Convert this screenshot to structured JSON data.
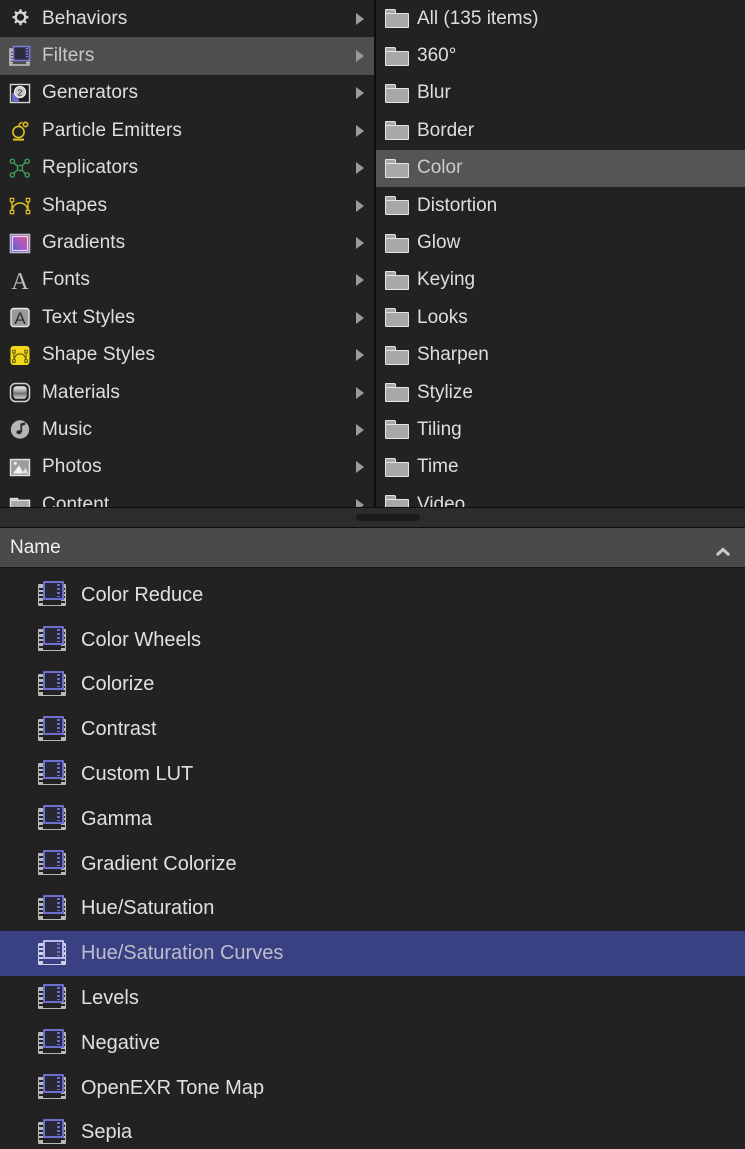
{
  "library": {
    "categories": [
      {
        "label": "Behaviors",
        "icon": "gear-icon",
        "selected": false,
        "has_submenu": true
      },
      {
        "label": "Filters",
        "icon": "film-strip-icon",
        "selected": true,
        "has_submenu": true
      },
      {
        "label": "Generators",
        "icon": "generator-icon",
        "selected": false,
        "has_submenu": true
      },
      {
        "label": "Particle Emitters",
        "icon": "particle-emitter-icon",
        "selected": false,
        "has_submenu": true
      },
      {
        "label": "Replicators",
        "icon": "replicator-icon",
        "selected": false,
        "has_submenu": true
      },
      {
        "label": "Shapes",
        "icon": "shape-curve-icon",
        "selected": false,
        "has_submenu": true
      },
      {
        "label": "Gradients",
        "icon": "gradient-swatch-icon",
        "selected": false,
        "has_submenu": true
      },
      {
        "label": "Fonts",
        "icon": "font-a-icon",
        "selected": false,
        "has_submenu": true
      },
      {
        "label": "Text Styles",
        "icon": "text-style-icon",
        "selected": false,
        "has_submenu": true
      },
      {
        "label": "Shape Styles",
        "icon": "shape-style-icon",
        "selected": false,
        "has_submenu": true
      },
      {
        "label": "Materials",
        "icon": "material-sphere-icon",
        "selected": false,
        "has_submenu": true
      },
      {
        "label": "Music",
        "icon": "music-note-icon",
        "selected": false,
        "has_submenu": true
      },
      {
        "label": "Photos",
        "icon": "photo-icon",
        "selected": false,
        "has_submenu": true
      },
      {
        "label": "Content",
        "icon": "folder-icon",
        "selected": false,
        "has_submenu": true
      }
    ],
    "subcategories": [
      {
        "label": "All (135 items)",
        "icon": "folder-icon",
        "selected": false
      },
      {
        "label": "360°",
        "icon": "folder-icon",
        "selected": false
      },
      {
        "label": "Blur",
        "icon": "folder-icon",
        "selected": false
      },
      {
        "label": "Border",
        "icon": "folder-icon",
        "selected": false
      },
      {
        "label": "Color",
        "icon": "folder-icon",
        "selected": true
      },
      {
        "label": "Distortion",
        "icon": "folder-icon",
        "selected": false
      },
      {
        "label": "Glow",
        "icon": "folder-icon",
        "selected": false
      },
      {
        "label": "Keying",
        "icon": "folder-icon",
        "selected": false
      },
      {
        "label": "Looks",
        "icon": "folder-icon",
        "selected": false
      },
      {
        "label": "Sharpen",
        "icon": "folder-icon",
        "selected": false
      },
      {
        "label": "Stylize",
        "icon": "folder-icon",
        "selected": false
      },
      {
        "label": "Tiling",
        "icon": "folder-icon",
        "selected": false
      },
      {
        "label": "Time",
        "icon": "folder-icon",
        "selected": false
      },
      {
        "label": "Video",
        "icon": "folder-icon",
        "selected": false
      }
    ]
  },
  "splitter": {
    "handle_name": "horizontal-splitter-handle"
  },
  "list_header": {
    "column_name": "Name",
    "sort_direction_icon": "chevron-up-icon"
  },
  "filter_list": {
    "items": [
      {
        "label": "Color Reduce",
        "icon": "filter-film-icon",
        "selected": false
      },
      {
        "label": "Color Wheels",
        "icon": "filter-film-icon",
        "selected": false
      },
      {
        "label": "Colorize",
        "icon": "filter-film-icon",
        "selected": false
      },
      {
        "label": "Contrast",
        "icon": "filter-film-icon",
        "selected": false
      },
      {
        "label": "Custom LUT",
        "icon": "filter-film-icon",
        "selected": false
      },
      {
        "label": "Gamma",
        "icon": "filter-film-icon",
        "selected": false
      },
      {
        "label": "Gradient Colorize",
        "icon": "filter-film-icon",
        "selected": false
      },
      {
        "label": "Hue/Saturation",
        "icon": "filter-film-icon",
        "selected": false
      },
      {
        "label": "Hue/Saturation Curves",
        "icon": "filter-film-icon",
        "selected": true
      },
      {
        "label": "Levels",
        "icon": "filter-film-icon",
        "selected": false
      },
      {
        "label": "Negative",
        "icon": "filter-film-icon",
        "selected": false
      },
      {
        "label": "OpenEXR Tone Map",
        "icon": "filter-film-icon",
        "selected": false
      },
      {
        "label": "Sepia",
        "icon": "filter-film-icon",
        "selected": false
      }
    ]
  },
  "colors": {
    "background": "#222222",
    "row_selected_grey": "#4f4f4f",
    "row_selected_blue": "#3a4182",
    "header_bar": "#4a4a4a",
    "text": "#dfdfdf",
    "icon_accent_purple": "#6f6fcf",
    "icon_accent_yellow": "#e8c731",
    "icon_accent_green": "#3fa85f"
  }
}
